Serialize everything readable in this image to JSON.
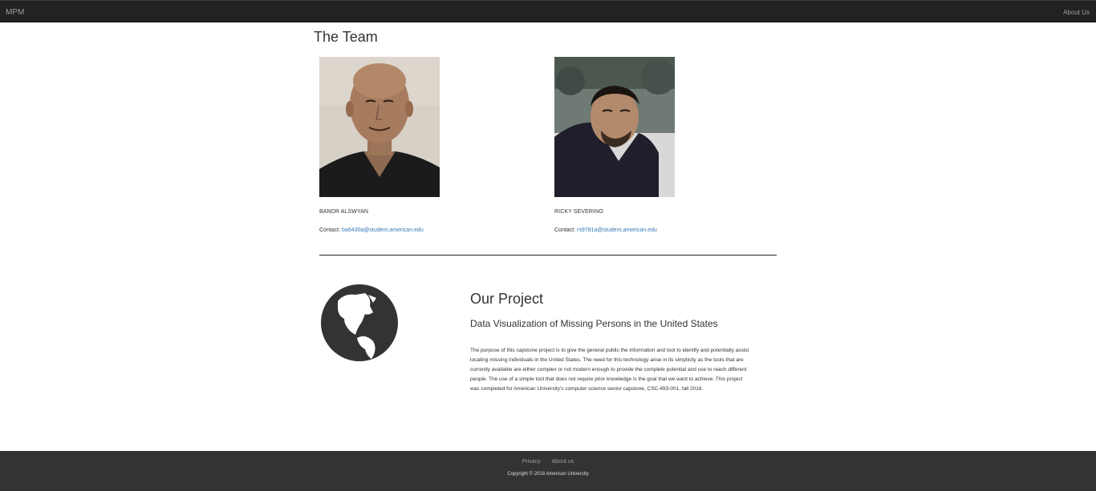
{
  "navbar": {
    "brand": "MPM",
    "about_label": "About Us"
  },
  "team": {
    "title": "The Team",
    "members": [
      {
        "name": "BANDR ALSWYAN",
        "contact_label": "Contact:",
        "email": "ba6430a@student.american.edu"
      },
      {
        "name": "RICKY SEVERINO",
        "contact_label": "Contact:",
        "email": "rs9781a@student.american.edu"
      }
    ]
  },
  "project": {
    "icon": "globe-americas-icon",
    "title": "Our Project",
    "subtitle": "Data Visualization of Missing Persons in the United States",
    "description": "The purpose of this capstone project is to give the general public the information and tool to identify and potentially assist locating missing individuals in the United States. The need for this technology arise in its simplicity as the tools that are currently available are either complex or not modern enough to provide the complete potential and use to reach different people. The use of a simple tool that does not require prior knowledge is the goal that we want to achieve. This project was completed for American University's computer science senior capstone, CSC-493-001, fall 2018."
  },
  "footer": {
    "privacy_label": "Privacy",
    "about_label": "About us",
    "copyright": "Copyright © 2018 American University"
  },
  "colors": {
    "navbar_bg": "#222222",
    "footer_bg": "#333333",
    "link": "#337ab7",
    "globe": "#333333"
  }
}
